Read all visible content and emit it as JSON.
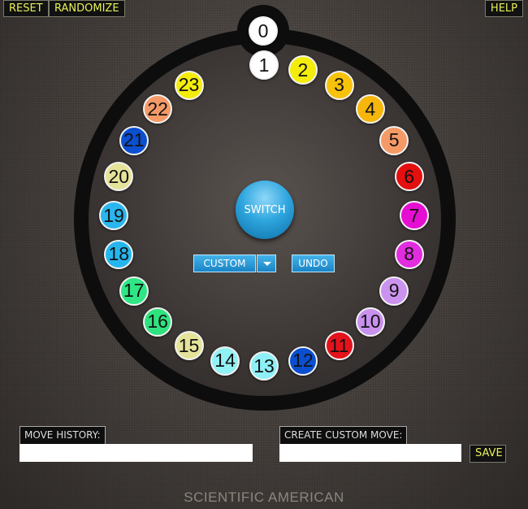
{
  "toolbar": {
    "reset_label": "RESET",
    "randomize_label": "RANDOMIZE",
    "help_label": "HELP"
  },
  "puzzle": {
    "top_slot": {
      "number": "0",
      "color": "#ffffff"
    },
    "ring": [
      {
        "number": "1",
        "color": "#ffffff"
      },
      {
        "number": "2",
        "color": "#f4ec0c"
      },
      {
        "number": "3",
        "color": "#f7c20a"
      },
      {
        "number": "4",
        "color": "#f6b60c"
      },
      {
        "number": "5",
        "color": "#f59a67"
      },
      {
        "number": "6",
        "color": "#e40f0f"
      },
      {
        "number": "7",
        "color": "#e60ed2"
      },
      {
        "number": "8",
        "color": "#e22ce0"
      },
      {
        "number": "9",
        "color": "#cb93ef"
      },
      {
        "number": "10",
        "color": "#c891ee"
      },
      {
        "number": "11",
        "color": "#e4121b"
      },
      {
        "number": "12",
        "color": "#0b4fd0"
      },
      {
        "number": "13",
        "color": "#8ef0f6"
      },
      {
        "number": "14",
        "color": "#92f1f4"
      },
      {
        "number": "15",
        "color": "#e5e39a"
      },
      {
        "number": "16",
        "color": "#2ee37f"
      },
      {
        "number": "17",
        "color": "#2fe584"
      },
      {
        "number": "18",
        "color": "#26b6ee"
      },
      {
        "number": "19",
        "color": "#2ab6ee"
      },
      {
        "number": "20",
        "color": "#e5e39a"
      },
      {
        "number": "21",
        "color": "#0c4fd0"
      },
      {
        "number": "22",
        "color": "#f59a67"
      },
      {
        "number": "23",
        "color": "#f4ec0c"
      }
    ]
  },
  "controls": {
    "switch_label": "SWITCH",
    "custom_label": "CUSTOM",
    "undo_label": "UNDO"
  },
  "move_history": {
    "label": "MOVE HISTORY:",
    "value": ""
  },
  "custom_move": {
    "label": "CREATE CUSTOM MOVE:",
    "value": "",
    "save_label": "SAVE"
  },
  "footer": {
    "brand": "SCIENTIFIC AMERICAN"
  }
}
